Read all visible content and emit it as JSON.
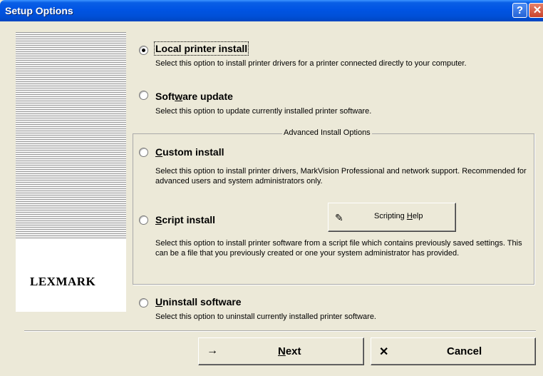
{
  "window": {
    "title": "Setup Options"
  },
  "sidebar": {
    "logo": "LEXMARK"
  },
  "options": {
    "local": {
      "title": "Local printer install",
      "description": "Select this option to install printer drivers for a printer connected directly to your computer.",
      "selected": true
    },
    "software_update": {
      "title_before": "Soft",
      "title_key": "w",
      "title_after": "are update",
      "description": "Select this option to update currently installed printer software.",
      "selected": false
    },
    "advanced_group_label": "Advanced Install Options",
    "custom": {
      "title_key": "C",
      "title_after": "ustom install",
      "description": "Select this option to install printer drivers, MarkVision Professional and network support. Recommended for advanced users and system administrators only.",
      "selected": false
    },
    "script": {
      "title_key": "S",
      "title_after": "cript install",
      "description": "Select this option to install printer software from a script file which contains previously saved settings. This can be a file that you previously created or one your system administrator has provided.",
      "selected": false
    },
    "uninstall": {
      "title_key": "U",
      "title_after": "ninstall software",
      "description": "Select this option to uninstall currently installed printer software.",
      "selected": false
    }
  },
  "scripting_help": {
    "label_before": "Scripting ",
    "label_key": "H",
    "label_after": "elp",
    "icon": "script-scroll-icon"
  },
  "footer": {
    "next_icon": "→",
    "next_key": "N",
    "next_after": "ext",
    "cancel_icon": "✕",
    "cancel_label": "Cancel"
  }
}
